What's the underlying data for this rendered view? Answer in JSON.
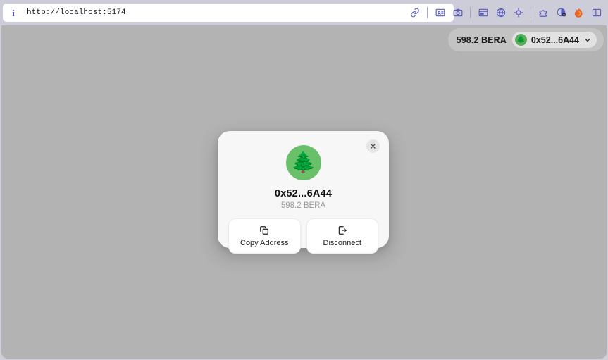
{
  "browser": {
    "url": "http://localhost:5174",
    "info_icon": "info-icon",
    "toolbar_icons": [
      {
        "name": "link-icon"
      },
      {
        "name": "separator"
      },
      {
        "name": "contact-card-icon"
      },
      {
        "name": "camera-icon"
      },
      {
        "name": "separator"
      },
      {
        "name": "window-panel-icon"
      },
      {
        "name": "globe-icon"
      },
      {
        "name": "crosshair-target-icon"
      },
      {
        "name": "separator"
      },
      {
        "name": "extension-icon"
      },
      {
        "name": "shield-privacy-icon"
      },
      {
        "name": "firefox-icon"
      },
      {
        "name": "sidebar-toggle-icon"
      }
    ]
  },
  "header": {
    "balance": "598.2 BERA",
    "address": "0x52...6A44",
    "avatar_glyph": "🌲",
    "chevron_icon": "chevron-down-icon"
  },
  "modal": {
    "close_icon": "close-icon",
    "avatar_glyph": "🌲",
    "address": "0x52...6A44",
    "balance": "598.2 BERA",
    "actions": [
      {
        "label": "Copy Address",
        "icon": "copy-icon"
      },
      {
        "label": "Disconnect",
        "icon": "logout-icon"
      }
    ]
  },
  "colors": {
    "avatar_green": "#68c168",
    "page_background": "#b3b3b3",
    "modal_background": "#f7f7f7",
    "chrome_background": "#cdcdd9",
    "toolbar_icon": "#5a5ac0"
  }
}
